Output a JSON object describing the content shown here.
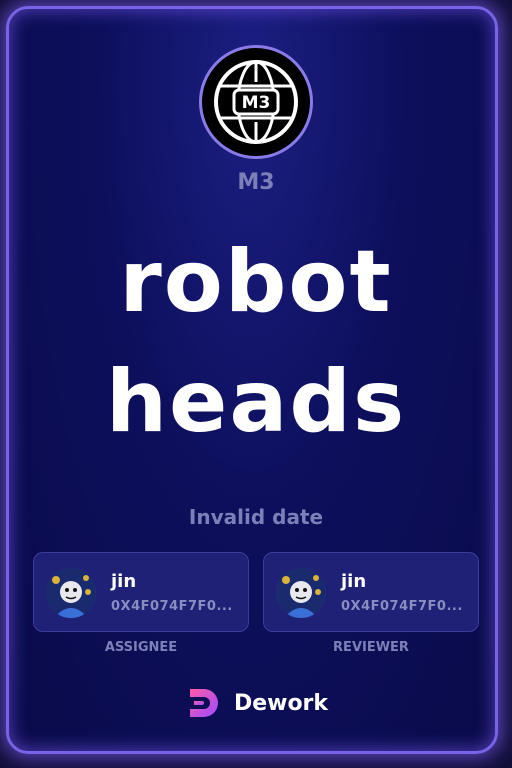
{
  "organization": {
    "logo_text": "M3",
    "name": "M3"
  },
  "task": {
    "title_line1": "robot",
    "title_line2": "heads",
    "date": "Invalid date"
  },
  "assignee": {
    "name": "jin",
    "address": "0X4F074F7F0...",
    "role": "ASSIGNEE"
  },
  "reviewer": {
    "name": "jin",
    "address": "0X4F074F7F0...",
    "role": "REVIEWER"
  },
  "footer": {
    "brand": "Dework"
  },
  "colors": {
    "accent": "#7a63e6",
    "background": "#0d0f5c",
    "muted_text": "#7d80b8"
  }
}
